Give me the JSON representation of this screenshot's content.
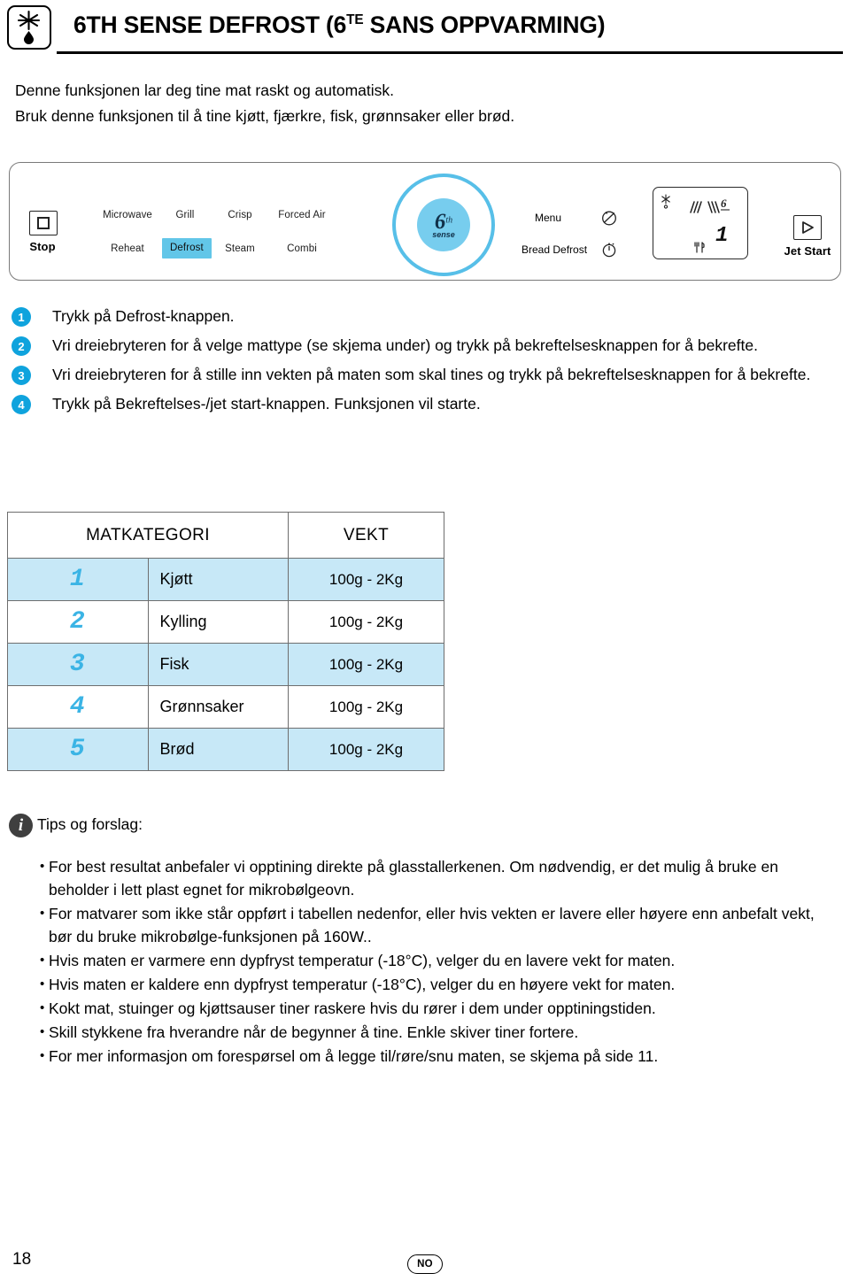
{
  "header": {
    "icon_name": "snowflake-drop-icon",
    "title_main": "6TH SENSE DEFROST (6",
    "title_sup": "TE",
    "title_tail": " SANS OPPVARMING)"
  },
  "intro": {
    "line1": "Denne funksjonen lar deg tine mat raskt og automatisk.",
    "line2": "Bruk denne funksjonen til å tine kjøtt, fjærkre, fisk, grønnsaker eller brød."
  },
  "panel": {
    "stop_label": "Stop",
    "modes_top": [
      "Microwave",
      "Grill",
      "Crisp",
      "Forced Air"
    ],
    "modes_bottom": [
      "Reheat",
      "Defrost",
      "Steam",
      "Combi"
    ],
    "highlighted_mode": "Defrost",
    "dial": {
      "six": "6",
      "th": "th",
      "sense": "sense"
    },
    "menu_label": "Menu",
    "bread_defrost_label": "Bread Defrost",
    "jet_start_label": "Jet Start",
    "lcd": {
      "digit": "1"
    }
  },
  "steps": [
    {
      "num": "1",
      "text": "Trykk på Defrost-knappen."
    },
    {
      "num": "2",
      "text": "Vri dreiebryteren for å velge mattype (se skjema under) og trykk på bekreftelsesknappen for å bekrefte."
    },
    {
      "num": "3",
      "text": "Vri dreiebryteren for å stille inn vekten på maten som skal tines og trykk på bekreftelsesknappen for å bekrefte."
    },
    {
      "num": "4",
      "text": "Trykk på Bekreftelses-/jet start-knappen. Funksjonen vil starte."
    }
  ],
  "table": {
    "headers": [
      "MATKATEGORI",
      "VEKT"
    ],
    "rows": [
      {
        "num": "1",
        "category": "Kjøtt",
        "weight": "100g - 2Kg"
      },
      {
        "num": "2",
        "category": "Kylling",
        "weight": "100g - 2Kg"
      },
      {
        "num": "3",
        "category": "Fisk",
        "weight": "100g - 2Kg"
      },
      {
        "num": "4",
        "category": "Grønnsaker",
        "weight": "100g - 2Kg"
      },
      {
        "num": "5",
        "category": "Brød",
        "weight": "100g - 2Kg"
      }
    ]
  },
  "tips": {
    "icon_letter": "i",
    "title": "Tips og forslag:",
    "bullet": "•",
    "items": [
      "For best resultat anbefaler vi opptining direkte på glasstallerkenen. Om nødvendig, er det mulig å bruke en beholder i lett plast egnet for mikrobølgeovn.",
      "For matvarer som ikke står oppført i tabellen nedenfor, eller hvis vekten er lavere eller høyere enn anbefalt vekt, bør du bruke mikrobølge-funksjonen på 160W..",
      "Hvis maten er varmere enn dypfryst temperatur (-18°C), velger du en lavere vekt for maten.",
      "Hvis maten er kaldere enn dypfryst temperatur (-18°C), velger du en høyere vekt for maten.",
      "Kokt mat, stuinger og kjøttsauser tiner raskere hvis du rører i dem under opptiningstiden.",
      "Skill stykkene fra hverandre når de begynner å tine. Enkle skiver tiner fortere.",
      "For mer informasjon om forespørsel om å legge til/røre/snu maten, se skjema på side 11."
    ]
  },
  "footer": {
    "page_number": "18",
    "language_code": "NO"
  },
  "colors": {
    "accent_blue": "#0fa3dd",
    "panel_highlight": "#62c6e8",
    "table_row_alt": "#c7e8f7",
    "segment_digit": "#3bb4e5",
    "dial_ring": "#57bfe8"
  }
}
